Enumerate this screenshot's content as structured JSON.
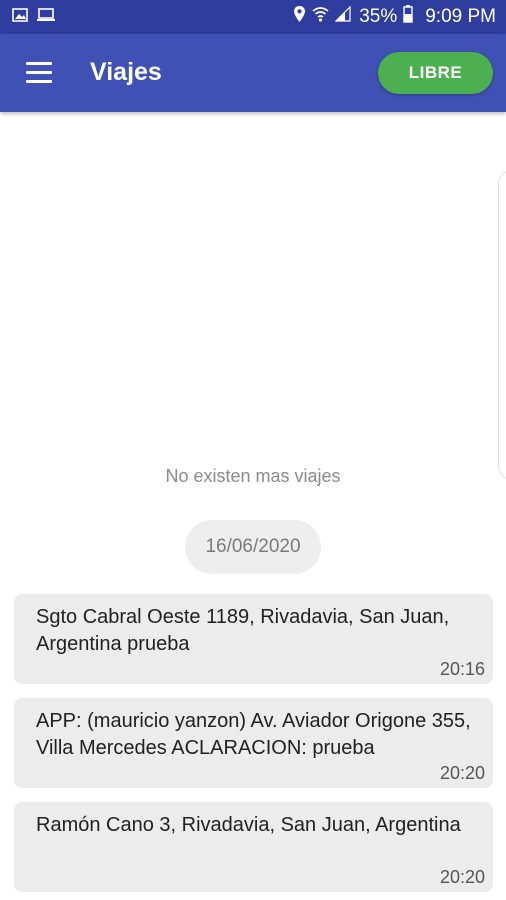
{
  "status_bar": {
    "battery": "35%",
    "time": "9:09 PM",
    "icons": [
      "image-icon",
      "cast-icon",
      "location-icon",
      "wifi-icon",
      "signal-icon",
      "battery-icon"
    ]
  },
  "app_bar": {
    "title": "Viajes",
    "status_button": "LIBRE",
    "colors": {
      "primary": "#3f51b5",
      "status_bar": "#2f3e9e",
      "status_button": "#4caf50"
    }
  },
  "feed": {
    "empty_text": "No existen mas viajes",
    "date": "16/06/2020",
    "trips": [
      {
        "address": "Sgto Cabral Oeste 1189, Rivadavia, San Juan, Argentina prueba",
        "time": "20:16"
      },
      {
        "address": "APP: (mauricio yanzon) Av. Aviador Origone 355, Villa Mercedes ACLARACION: prueba",
        "time": "20:20"
      },
      {
        "address": "Ramón Cano 3, Rivadavia, San Juan, Argentina",
        "time": "20:20"
      }
    ]
  }
}
